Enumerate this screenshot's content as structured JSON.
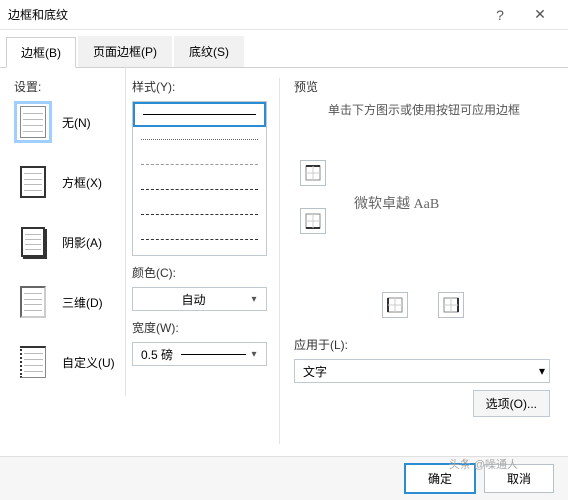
{
  "dialog": {
    "title": "边框和底纹"
  },
  "tabs": [
    {
      "label": "边框(B)",
      "key": "border"
    },
    {
      "label": "页面边框(P)",
      "key": "page-border"
    },
    {
      "label": "底纹(S)",
      "key": "shading"
    }
  ],
  "settings": {
    "label": "设置:",
    "items": [
      {
        "label": "无(N)",
        "key": "none"
      },
      {
        "label": "方框(X)",
        "key": "box"
      },
      {
        "label": "阴影(A)",
        "key": "shadow"
      },
      {
        "label": "三维(D)",
        "key": "3d"
      },
      {
        "label": "自定义(U)",
        "key": "custom"
      }
    ]
  },
  "style": {
    "label": "样式(Y):"
  },
  "color": {
    "label": "颜色(C):",
    "value": "自动"
  },
  "width": {
    "label": "宽度(W):",
    "value": "0.5 磅"
  },
  "preview": {
    "label": "预览",
    "hint": "单击下方图示或使用按钮可应用边框",
    "sample": "微软卓越  AaB"
  },
  "apply": {
    "label": "应用于(L):",
    "value": "文字"
  },
  "options": {
    "label": "选项(O)..."
  },
  "footer": {
    "ok": "确定",
    "cancel": "取消",
    "watermark": "头条 @噪通人"
  }
}
